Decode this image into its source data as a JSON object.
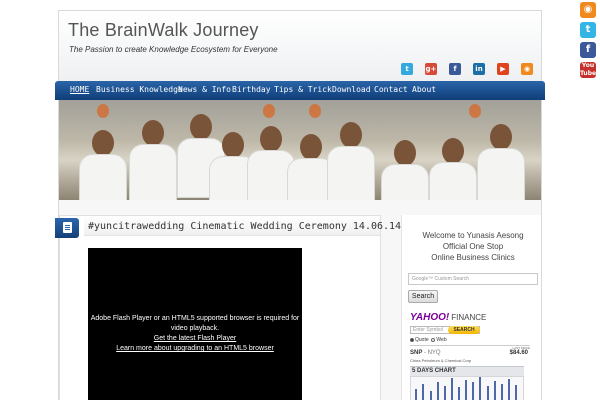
{
  "site": {
    "title": "The BrainWalk Journey",
    "tagline": "The Passion to create Knowledge Ecosystem for Everyone"
  },
  "side_social": [
    {
      "icon": "rss-icon",
      "glyph": "◉"
    },
    {
      "icon": "twitter-icon",
      "glyph": "t"
    },
    {
      "icon": "facebook-icon",
      "glyph": "f"
    },
    {
      "icon": "youtube-icon",
      "glyph": "You Tube"
    }
  ],
  "header_social": [
    {
      "icon": "twitter-icon",
      "glyph": "t",
      "color": "#33a9e0"
    },
    {
      "icon": "google-plus-icon",
      "glyph": "g+",
      "color": "#d84a38"
    },
    {
      "icon": "facebook-icon",
      "glyph": "f",
      "color": "#3b5998"
    },
    {
      "icon": "linkedin-icon",
      "glyph": "in",
      "color": "#1b6fa6"
    },
    {
      "icon": "youtube-icon",
      "glyph": "▶",
      "color": "#e0441e"
    },
    {
      "icon": "rss-icon",
      "glyph": "◉",
      "color": "#f08a1e"
    }
  ],
  "nav": {
    "items": [
      "HOME",
      "Business Knowledge",
      "News & Info",
      "Birthday",
      "Tips & Trick",
      "Download",
      "Contact",
      "About"
    ],
    "active": "HOME"
  },
  "post": {
    "title": "#yuncitrawedding Cinematic Wedding Ceremony 14.06.14"
  },
  "video": {
    "message": "Adobe Flash Player or an HTML5 supported browser is required for video playback.",
    "link1": "Get the latest Flash Player",
    "link2": "Learn more about upgrading to an HTML5 browser"
  },
  "sidebar": {
    "welcome_line1": "Welcome to Yunasis Aesong",
    "welcome_line2": "Official One Stop",
    "welcome_line3": "Online Business Clinics",
    "search_placeholder": "Google™ Custom Search",
    "search_button": "Search"
  },
  "yahoo": {
    "logo": "YAHOO!",
    "logo_suffix": "FINANCE",
    "symbol_placeholder": "Enter Symbol",
    "search_button": "SEARCH",
    "radio_quote": "Quote",
    "radio_web": "Web",
    "header_last_price": "LAST PRICE",
    "symbol": "SNP",
    "exchange": "- NYQ",
    "price": "$84.60",
    "company": "China Petroleum & Chemical Corp",
    "chart_title": "5 DAYS CHART",
    "chart_bars": [
      40,
      55,
      35,
      60,
      50,
      70,
      45,
      65,
      58,
      72,
      48,
      62,
      55,
      68,
      52
    ]
  },
  "colors": {
    "nav_top": "#2a64a8",
    "nav_bottom": "#0f3e78",
    "yahoo_purple": "#7b0099"
  }
}
